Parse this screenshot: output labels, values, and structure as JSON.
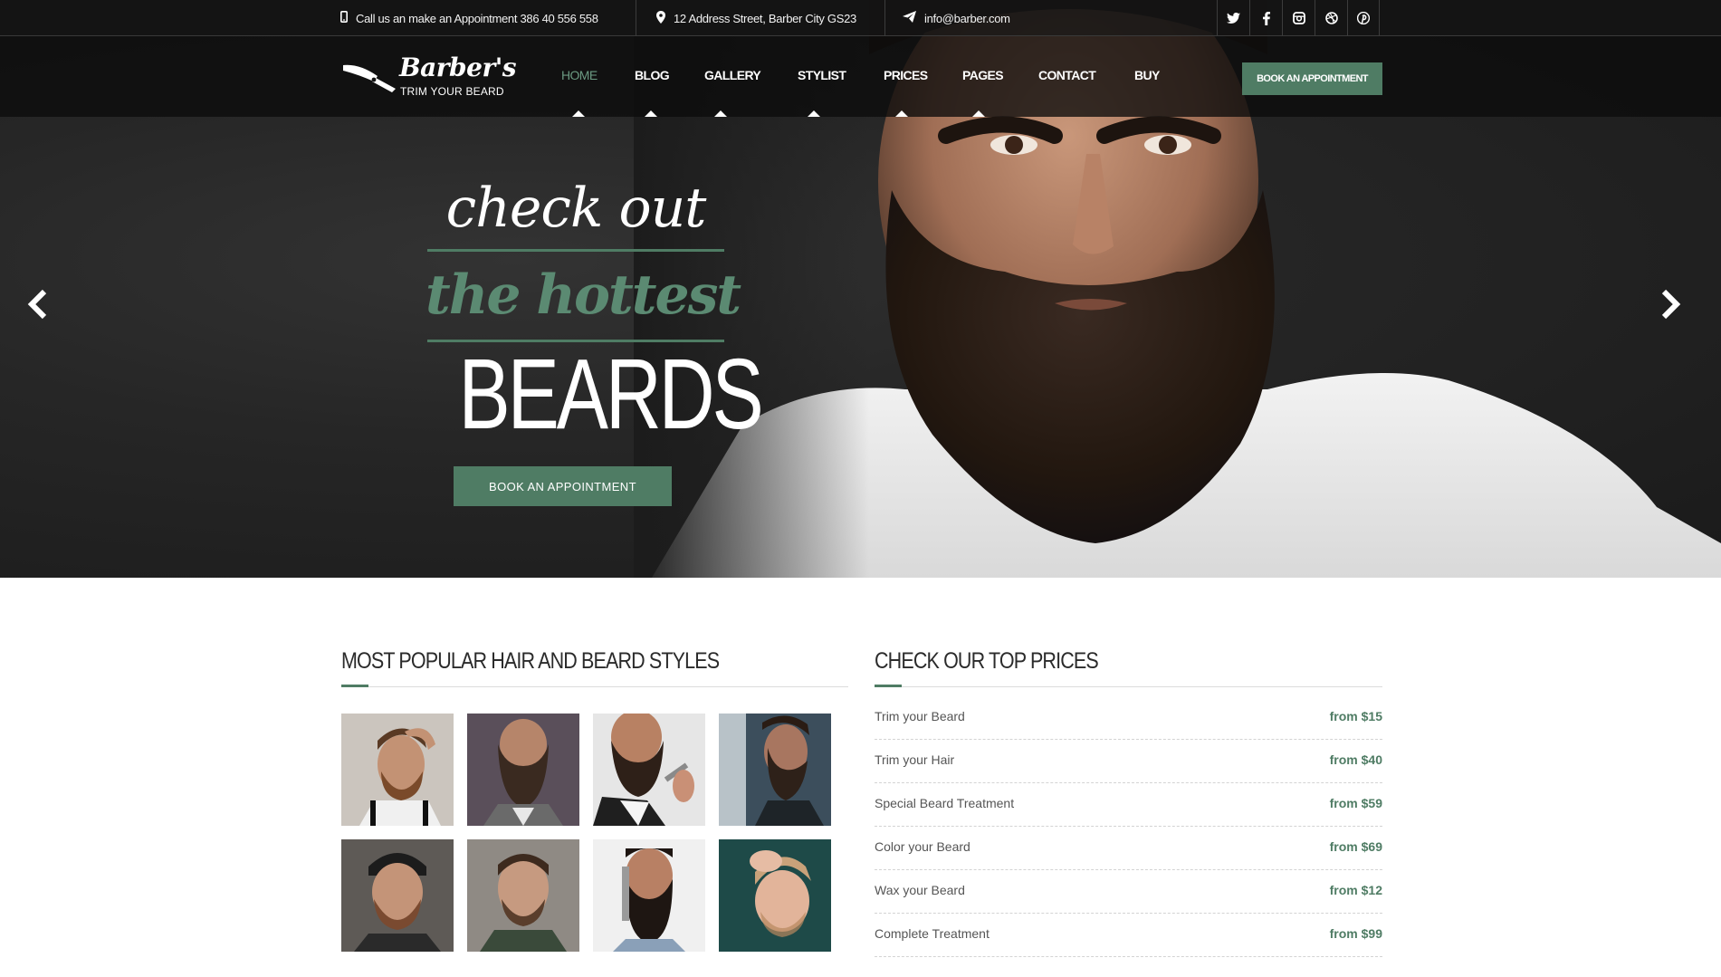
{
  "topbar": {
    "phone_text": "Call us an make an Appointment 386 40 556 558",
    "address_text": "12 Address Street, Barber City GS23",
    "email_text": "info@barber.com",
    "socials": [
      "twitter-icon",
      "facebook-icon",
      "instagram-icon",
      "dribbble-icon",
      "pinterest-icon"
    ]
  },
  "logo": {
    "brand": "Barber's",
    "tagline": "TRIM YOUR BEARD"
  },
  "nav": {
    "items": [
      {
        "label": "HOME",
        "active": true
      },
      {
        "label": "BLOG",
        "active": false
      },
      {
        "label": "GALLERY",
        "active": false
      },
      {
        "label": "STYLIST",
        "active": false
      },
      {
        "label": "PRICES",
        "active": false
      },
      {
        "label": "PAGES",
        "active": false
      },
      {
        "label": "CONTACT",
        "active": false
      },
      {
        "label": "BUY",
        "active": false
      }
    ],
    "cta_label": "BOOK AN APPOINTMENT"
  },
  "hero": {
    "line1": "check out",
    "line2": "the hottest",
    "line3": "BEARDS",
    "cta_label": "BOOK AN APPOINTMENT",
    "prev_icon": "chevron-left-icon",
    "next_icon": "chevron-right-icon"
  },
  "styles_section": {
    "title": "MOST POPULAR HAIR AND BEARD STYLES"
  },
  "prices_section": {
    "title": "CHECK OUR TOP PRICES",
    "items": [
      {
        "name": "Trim your Beard",
        "price": "from $15"
      },
      {
        "name": "Trim your Hair",
        "price": "from $40"
      },
      {
        "name": "Special Beard Treatment",
        "price": "from $59"
      },
      {
        "name": "Color your Beard",
        "price": "from $69"
      },
      {
        "name": "Wax your Beard",
        "price": "from $12"
      },
      {
        "name": "Complete Treatment",
        "price": "from $99"
      }
    ]
  },
  "colors": {
    "accent": "#4f7c64",
    "accent_light": "#6b9a82",
    "dark": "#1a1a1a"
  }
}
